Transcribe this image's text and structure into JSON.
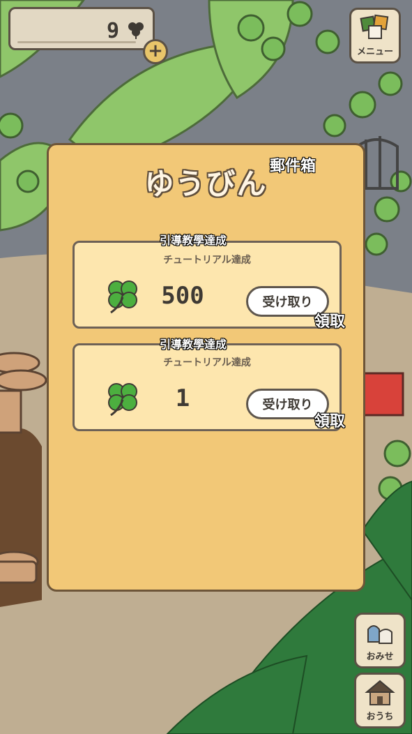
{
  "currency": {
    "clover_count": "9"
  },
  "menu": {
    "label": "メニュー"
  },
  "shop": {
    "label": "おみせ"
  },
  "home": {
    "label": "おうち"
  },
  "mailbox": {
    "title": "ゆうびん",
    "title_translation": "郵件箱",
    "mails": [
      {
        "subject": "チュートリアル達成",
        "subject_translation": "引導教學達成",
        "amount": "500",
        "receive_label": "受け取り",
        "receive_translation": "領取"
      },
      {
        "subject": "チュートリアル達成",
        "subject_translation": "引導教學達成",
        "amount": "1",
        "receive_label": "受け取り",
        "receive_translation": "領取"
      }
    ]
  },
  "colors": {
    "panel": "#f2c877",
    "card": "#fde6ae",
    "clover_green": "#4caf3f",
    "outline": "#5b5145"
  }
}
